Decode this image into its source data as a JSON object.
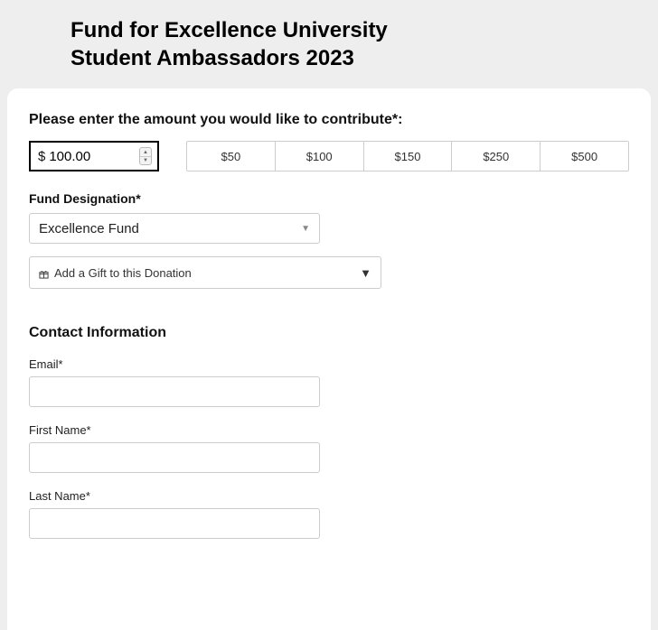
{
  "header": {
    "title_line1": "Fund for Excellence University",
    "title_line2": "Student Ambassadors 2023"
  },
  "amount": {
    "prompt": "Please enter the amount you would like to contribute*:",
    "currency_symbol": "$",
    "value": "100.00",
    "presets": [
      "$50",
      "$100",
      "$150",
      "$250",
      "$500"
    ]
  },
  "fund": {
    "label": "Fund Designation*",
    "selected": "Excellence Fund"
  },
  "gift": {
    "label": "Add a Gift to this Donation"
  },
  "contact": {
    "section_title": "Contact Information",
    "email_label": "Email*",
    "first_name_label": "First Name*",
    "last_name_label": "Last Name*",
    "email_value": "",
    "first_name_value": "",
    "last_name_value": ""
  }
}
